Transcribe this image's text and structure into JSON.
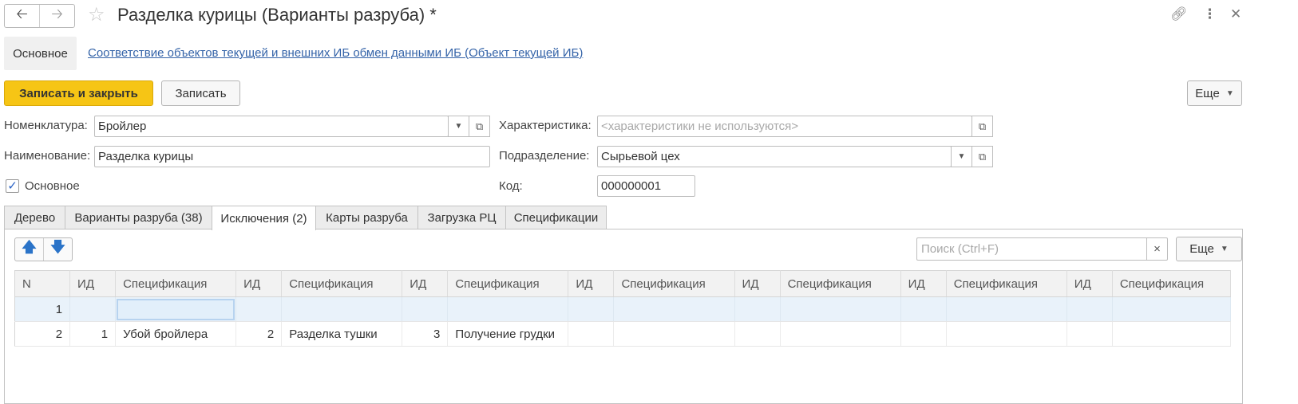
{
  "window": {
    "title": "Разделка курицы (Варианты разруба) *",
    "icons": [
      "back-arrow-icon",
      "forward-arrow-icon",
      "star-icon",
      "link-icon",
      "more-vertical-icon",
      "close-icon"
    ]
  },
  "sections": {
    "main": "Основное",
    "link": "Соответствие объектов текущей и внешних ИБ обмен данными ИБ (Объект текущей ИБ)"
  },
  "toolbar": {
    "save_close": "Записать и закрыть",
    "save": "Записать",
    "more": "Еще"
  },
  "form": {
    "nomenclature_label": "Номенклатура:",
    "nomenclature_value": "Бройлер",
    "name_label": "Наименование:",
    "name_value": "Разделка курицы",
    "main_checkbox_label": "Основное",
    "main_checked": true,
    "characteristic_label": "Характеристика:",
    "characteristic_placeholder": "<характеристики не используются>",
    "division_label": "Подразделение:",
    "division_value": "Сырьевой цех",
    "code_label": "Код:",
    "code_value": "000000001"
  },
  "tabs": [
    {
      "label": "Дерево"
    },
    {
      "label": "Варианты разруба (38)"
    },
    {
      "label": "Исключения (2)",
      "active": true
    },
    {
      "label": "Карты разруба"
    },
    {
      "label": "Загрузка РЦ"
    },
    {
      "label": "Спецификации"
    }
  ],
  "table_toolbar": {
    "search_placeholder": "Поиск (Ctrl+F)",
    "clear": "×",
    "more": "Еще"
  },
  "grid": {
    "columns": [
      "N",
      "ИД",
      "Спецификация",
      "ИД",
      "Спецификация",
      "ИД",
      "Спецификация",
      "ИД",
      "Спецификация",
      "ИД",
      "Спецификация",
      "ИД",
      "Спецификация",
      "ИД",
      "Спецификация"
    ],
    "rows": [
      {
        "cells": [
          "1",
          "",
          "",
          "",
          "",
          "",
          "",
          "",
          "",
          "",
          "",
          "",
          "",
          "",
          ""
        ],
        "selected": true
      },
      {
        "cells": [
          "2",
          "1",
          "Убой бройлера",
          "2",
          "Разделка тушки",
          "3",
          "Получение грудки",
          "",
          "",
          "",
          "",
          "",
          "",
          "",
          ""
        ],
        "selected": false
      }
    ]
  },
  "colors": {
    "accent": "#f6c515",
    "link": "#3463a8",
    "selection": "#e9f2fa"
  }
}
